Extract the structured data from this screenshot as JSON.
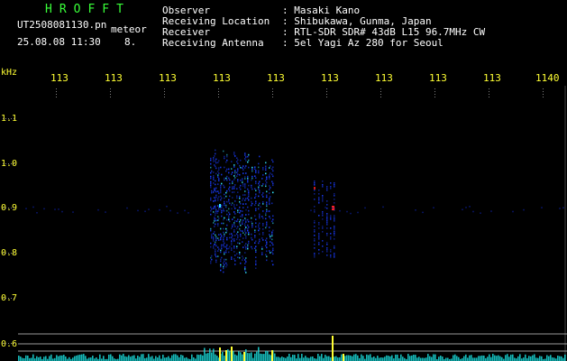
{
  "header": {
    "station": "HROFFT",
    "filename": "UT2508081130.pn",
    "mode": "meteor",
    "datetime": "25.08.08 11:30",
    "count": "8.",
    "labels": {
      "observer": "Observer",
      "location": "Receiving Location",
      "receiver": "Receiver",
      "antenna": "Receiving Antenna"
    },
    "values": {
      "observer": ": Masaki Kano",
      "location": ": Shibukawa, Gunma, Japan",
      "receiver": ": RTL-SDR SDR# 43dB L15 96.7MHz CW",
      "antenna": ": 5el Yagi Az 280 for Seoul"
    }
  },
  "axes": {
    "y_unit": "kHz",
    "y_ticks": [
      "1.1",
      "1.0",
      "0.9",
      "0.8",
      "0.7",
      "0.6"
    ],
    "x_ticks": [
      "113",
      "113",
      "113",
      "113",
      "113",
      "113",
      "113",
      "113",
      "113",
      "1140"
    ]
  },
  "colors": {
    "header_green": "#39ff39",
    "header_text": "#ffffff",
    "axis_yellow": "#ffff33",
    "echo_blue": "#1a3cff",
    "echo_cyan": "#33e6ff",
    "echo_red": "#ff2020"
  }
}
